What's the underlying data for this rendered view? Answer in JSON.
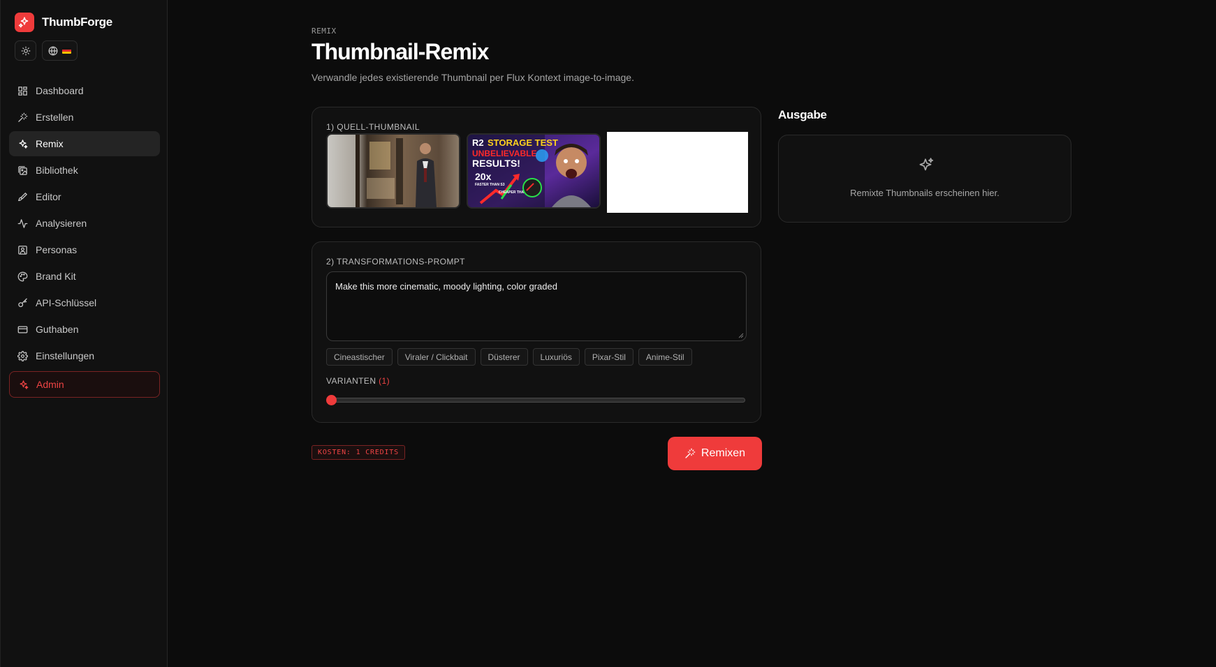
{
  "app": {
    "name": "ThumbForge"
  },
  "colors": {
    "accent": "#ef3b3b",
    "background": "#0c0c0c",
    "sidebar": "#111111"
  },
  "sidebar": {
    "theme_icon": "sun-icon",
    "language_icon": "globe-icon",
    "language_flag": "german-flag",
    "items": [
      {
        "label": "Dashboard",
        "icon": "dashboard-icon"
      },
      {
        "label": "Erstellen",
        "icon": "magic-wand-icon"
      },
      {
        "label": "Remix",
        "icon": "sparkles-icon",
        "active": true
      },
      {
        "label": "Bibliothek",
        "icon": "images-icon"
      },
      {
        "label": "Editor",
        "icon": "brush-icon"
      },
      {
        "label": "Analysieren",
        "icon": "activity-icon"
      },
      {
        "label": "Personas",
        "icon": "user-square-icon"
      },
      {
        "label": "Brand Kit",
        "icon": "palette-icon"
      },
      {
        "label": "API-Schlüssel",
        "icon": "key-icon"
      },
      {
        "label": "Guthaben",
        "icon": "credit-card-icon"
      },
      {
        "label": "Einstellungen",
        "icon": "gear-icon"
      }
    ],
    "admin": {
      "label": "Admin",
      "icon": "sparkles-icon"
    }
  },
  "page": {
    "eyebrow": "REMIX",
    "title": "Thumbnail-Remix",
    "subtitle": "Verwandle jedes existierende Thumbnail per Flux Kontext image-to-image."
  },
  "source": {
    "label": "1) QUELL-THUMBNAIL",
    "thumb2": {
      "line1a": "R2",
      "line1b": "STORAGE TEST",
      "line2": "UNBELIEVABLE",
      "line3": "RESULTS!",
      "stat": "20x",
      "stat_sub": "FASTER THAN S3",
      "small": "CHEAPER THAN AWS"
    }
  },
  "prompt": {
    "label": "2) TRANSFORMATIONS-PROMPT",
    "value": "Make this more cinematic, moody lighting, color graded",
    "chips": [
      "Cineastischer",
      "Viraler / Clickbait",
      "Düsterer",
      "Luxuriös",
      "Pixar-Stil",
      "Anime-Stil"
    ],
    "variants_label": "VARIANTEN",
    "variants_value": "(1)",
    "variants_count": 1
  },
  "footer": {
    "cost": "KOSTEN: 1 CREDITS",
    "remix_button": "Remixen"
  },
  "output": {
    "title": "Ausgabe",
    "empty_text": "Remixte Thumbnails erscheinen hier.",
    "icon": "sparkles-icon"
  }
}
